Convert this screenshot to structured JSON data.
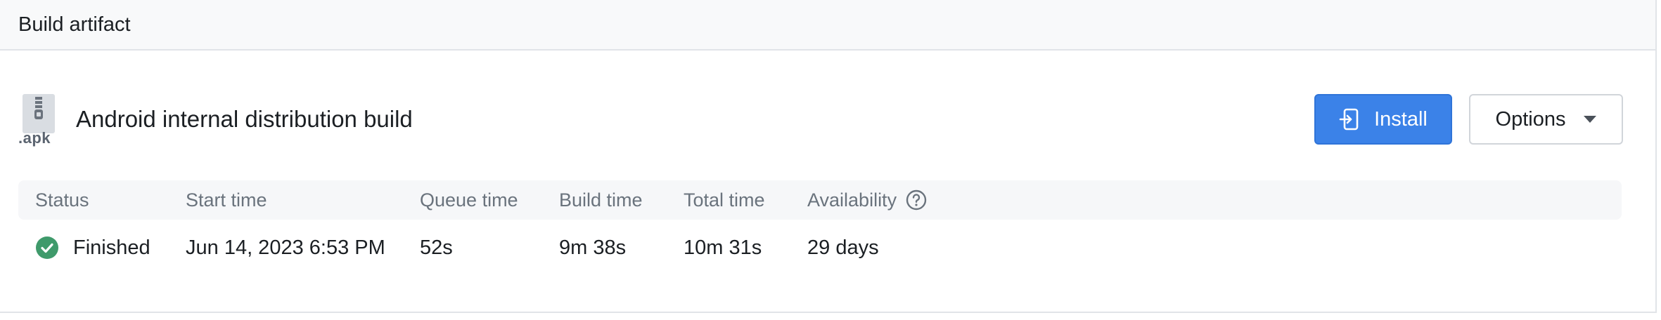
{
  "header": {
    "title": "Build artifact"
  },
  "artifact": {
    "file_ext": ".apk",
    "file_icon": "zip-file-icon",
    "title": "Android internal distribution build"
  },
  "actions": {
    "install_label": "Install",
    "install_icon": "install-arrow-icon",
    "options_label": "Options",
    "options_icon": "chevron-down-icon"
  },
  "table": {
    "columns": [
      "Status",
      "Start time",
      "Queue time",
      "Build time",
      "Total time",
      "Availability"
    ],
    "availability_help_icon": "help-circle-icon",
    "row": {
      "status": "Finished",
      "status_icon": "check-circle-icon",
      "start_time": "Jun 14, 2023 6:53 PM",
      "queue_time": "52s",
      "build_time": "9m 38s",
      "total_time": "10m 31s",
      "availability": "29 days"
    }
  },
  "colors": {
    "primary": "#3b82e8",
    "success": "#3f9a6b",
    "header_bg": "#f8f9fa",
    "table_header_bg": "#f6f7f9"
  }
}
